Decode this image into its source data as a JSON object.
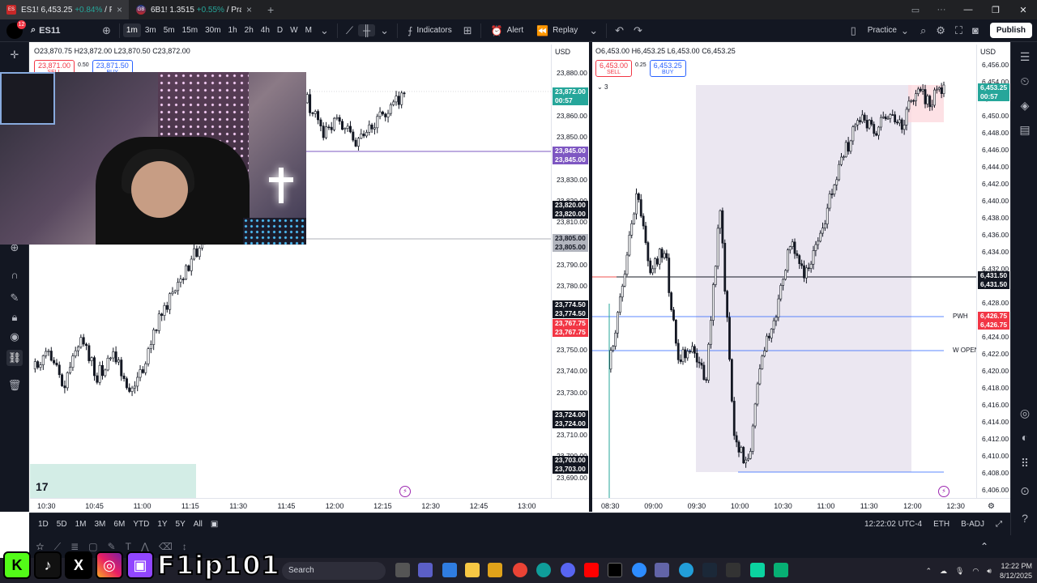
{
  "browser": {
    "tabs": [
      {
        "icon": "ES",
        "symbol": "ES1!",
        "price": "6,453.25",
        "change": "+0.84%",
        "rest": "/ Pra",
        "active": false
      },
      {
        "icon": "GB",
        "symbol": "6B1!",
        "price": "1.3515",
        "change": "+0.55%",
        "rest": "/ Prac",
        "active": true
      }
    ]
  },
  "toolbar": {
    "badge": "12",
    "symbol": "ES11",
    "timeframes": [
      "1m",
      "3m",
      "5m",
      "15m",
      "30m",
      "1h",
      "2h",
      "4h",
      "D",
      "W",
      "M"
    ],
    "active_tf": "1m",
    "indicators": "Indicators",
    "alert": "Alert",
    "replay": "Replay",
    "practice": "Practice",
    "publish": "Publish"
  },
  "left_chart": {
    "ohlc": {
      "o": "O23,870.75",
      "h": "H23,872.00",
      "l": "L23,870.50",
      "c": "C23,872.00"
    },
    "sell_price": "23,871.00",
    "sell_label": "SELL",
    "spread": "0.50",
    "buy_price": "23,871.50",
    "buy_label": "BUY",
    "currency": "USD",
    "price_ticks": [
      "23,880.00",
      "23,870.00",
      "23,860.00",
      "23,850.00",
      "23,840.00",
      "23,830.00",
      "23,820.00",
      "23,810.00",
      "23,800.00",
      "23,790.00",
      "23,780.00",
      "23,770.00",
      "23,760.00",
      "23,750.00",
      "23,740.00",
      "23,730.00",
      "23,720.00",
      "23,710.00",
      "23,700.00",
      "23,690.00"
    ],
    "price_labels": [
      {
        "text": "23,872.00",
        "sub": "00:57",
        "color": "#26a69a"
      },
      {
        "text": "23,845.00",
        "color": "#7e57c2"
      },
      {
        "text": "23,845.00",
        "color": "#7e57c2"
      },
      {
        "text": "23,820.00",
        "color": "#131722"
      },
      {
        "text": "23,820.00",
        "color": "#131722"
      },
      {
        "text": "23,805.00",
        "color": "#b2b5be"
      },
      {
        "text": "23,805.00",
        "color": "#b2b5be"
      },
      {
        "text": "23,774.50",
        "color": "#131722"
      },
      {
        "text": "23,774.50",
        "color": "#131722"
      },
      {
        "text": "23,767.75",
        "color": "#f23645"
      },
      {
        "text": "23,767.75",
        "color": "#f23645"
      },
      {
        "text": "23,724.00",
        "color": "#131722"
      },
      {
        "text": "23,724.00",
        "color": "#131722"
      },
      {
        "text": "23,703.00",
        "color": "#131722"
      },
      {
        "text": "23,703.00",
        "color": "#131722"
      }
    ],
    "time_ticks": [
      "10:30",
      "10:45",
      "11:00",
      "11:15",
      "11:30",
      "11:45",
      "12:00",
      "12:15",
      "12:30",
      "12:45",
      "13:00"
    ],
    "logo": "17"
  },
  "right_chart": {
    "ohlc": {
      "o": "O6,453.00",
      "h": "H6,453.25",
      "l": "L6,453.00",
      "c": "C6,453.25"
    },
    "sell_price": "6,453.00",
    "sell_label": "SELL",
    "spread": "0.25",
    "buy_price": "6,453.25",
    "buy_label": "BUY",
    "collapsed_count": "3",
    "currency": "USD",
    "price_ticks": [
      "6,456.00",
      "6,454.00",
      "6,452.00",
      "6,450.00",
      "6,448.00",
      "6,446.00",
      "6,444.00",
      "6,442.00",
      "6,440.00",
      "6,438.00",
      "6,436.00",
      "6,434.00",
      "6,432.00",
      "6,430.00",
      "6,428.00",
      "6,426.00",
      "6,424.00",
      "6,422.00",
      "6,420.00",
      "6,418.00",
      "6,416.00",
      "6,414.00",
      "6,412.00",
      "6,410.00",
      "6,408.00",
      "6,406.00"
    ],
    "price_labels": [
      {
        "text": "6,453.25",
        "sub": "00:57",
        "color": "#26a69a"
      },
      {
        "text": "6,431.50",
        "color": "#131722"
      },
      {
        "text": "6,431.50",
        "color": "#131722"
      },
      {
        "text": "6,426.75",
        "color": "#f23645"
      },
      {
        "text": "6,426.75",
        "color": "#f23645"
      }
    ],
    "line_labels": {
      "pwh": "PWH",
      "wopen": "W OPEN"
    },
    "time_ticks": [
      "08:30",
      "09:00",
      "09:30",
      "10:00",
      "10:30",
      "11:00",
      "11:30",
      "12:00",
      "12:30"
    ]
  },
  "bottom": {
    "ranges": [
      "1D",
      "5D",
      "1M",
      "3M",
      "6M",
      "YTD",
      "1Y",
      "5Y",
      "All"
    ],
    "clock": "12:22:02 UTC-4",
    "session": "ETH",
    "adj": "B-ADJ"
  },
  "taskbar": {
    "brand_name": "F1ip101",
    "search": "Search",
    "time": "12:22 PM",
    "date": "8/12/2025"
  },
  "colors": {
    "up": "#26a69a",
    "down": "#ef5350",
    "candle": "#131722",
    "purple": "#7e57c2",
    "accent": "#2962ff"
  }
}
